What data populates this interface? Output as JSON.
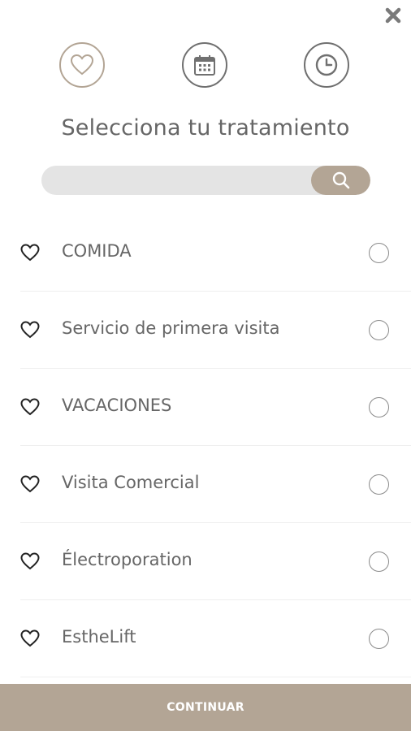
{
  "header": {
    "close_icon": "close-icon",
    "steps": [
      {
        "icon": "heart-icon",
        "active": true
      },
      {
        "icon": "calendar-icon",
        "active": false
      },
      {
        "icon": "clock-icon",
        "active": false
      }
    ],
    "title": "Selecciona tu tratamiento"
  },
  "search": {
    "value": "",
    "placeholder": "",
    "button_icon": "search-icon"
  },
  "treatments": [
    {
      "label": "COMIDA",
      "favorite_icon": "heart-icon",
      "selected": false
    },
    {
      "label": "Servicio de primera visita",
      "favorite_icon": "heart-icon",
      "selected": false
    },
    {
      "label": "VACACIONES",
      "favorite_icon": "heart-icon",
      "selected": false
    },
    {
      "label": "Visita Comercial",
      "favorite_icon": "heart-icon",
      "selected": false
    },
    {
      "label": "Électroporation",
      "favorite_icon": "heart-icon",
      "selected": false
    },
    {
      "label": "EstheLift",
      "favorite_icon": "heart-icon",
      "selected": false
    }
  ],
  "footer": {
    "continue_label": "CONTINUAR"
  },
  "colors": {
    "accent": "#b3a595",
    "search_bg": "#e4e4e4",
    "text": "#666666",
    "divider": "#efefef"
  }
}
